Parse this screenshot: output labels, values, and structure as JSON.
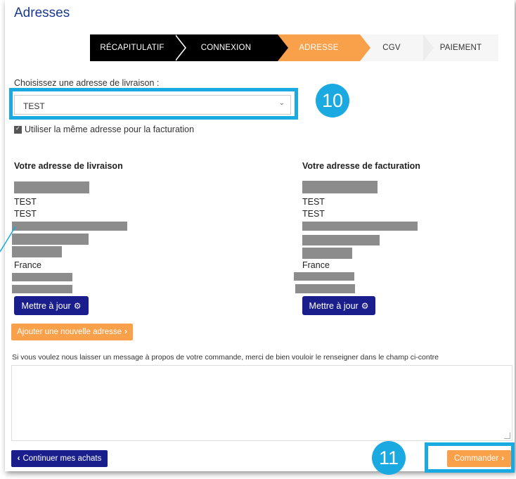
{
  "page": {
    "title": "Adresses"
  },
  "steps": [
    {
      "label": "RÉCAPITULATIF",
      "state": "done"
    },
    {
      "label": "CONNEXION",
      "state": "done"
    },
    {
      "label": "ADRESSE",
      "state": "active"
    },
    {
      "label": "CGV",
      "state": "todo"
    },
    {
      "label": "PAIEMENT",
      "state": "todo"
    }
  ],
  "delivery_select": {
    "label": "Choisissez une adresse de livraison :",
    "value": "TEST",
    "chevron_icon": "chevron-down-icon"
  },
  "annotations": {
    "badge_select": "10",
    "badge_order": "11",
    "highlight_color": "#1ba9e1"
  },
  "same_address": {
    "label": "Utiliser la même adresse pour la facturation",
    "checked": true
  },
  "delivery_address": {
    "title": "Votre adresse de livraison",
    "line1": "TEST",
    "line2": "TEST",
    "country": "France",
    "update_label": "Mettre à jour",
    "update_icon": "gear-icon"
  },
  "billing_address": {
    "title": "Votre adresse de facturation",
    "line1": "TEST",
    "line2": "TEST",
    "country": "France",
    "update_label": "Mettre à jour",
    "update_icon": "gear-icon"
  },
  "add_address": {
    "label": "Ajouter une nouvelle adresse",
    "icon": "chevron-right-icon"
  },
  "message": {
    "label": "Si vous voulez nous laisser un message à propos de votre commande, merci de bien vouloir le renseigner dans le champ ci-contre",
    "value": ""
  },
  "footer": {
    "continue_label": "Continuer mes achats",
    "continue_icon": "chevron-left-icon",
    "order_label": "Commander",
    "order_icon": "chevron-right-icon"
  },
  "colors": {
    "navy": "#1a1e8c",
    "orange": "#f8a04a",
    "title_blue": "#1a3a8f"
  }
}
